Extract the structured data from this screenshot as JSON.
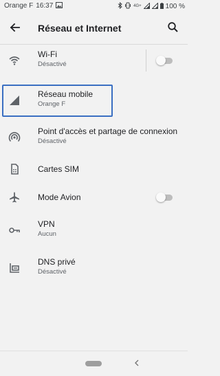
{
  "status_bar": {
    "carrier": "Orange F",
    "time": "16:37",
    "network": "4G+",
    "battery": "100 %"
  },
  "appbar": {
    "title": "Réseau et Internet"
  },
  "items": [
    {
      "label": "Wi-Fi",
      "sub": "Désactivé",
      "icon": "wifi-icon",
      "toggle_on": false
    },
    {
      "label": "Réseau mobile",
      "sub": "Orange F",
      "icon": "cellular-signal-icon"
    },
    {
      "label": "Point d'accès et partage de connexion",
      "sub": "Désactivé",
      "icon": "hotspot-icon"
    },
    {
      "label": "Cartes SIM",
      "icon": "sim-card-icon"
    },
    {
      "label": "Mode Avion",
      "icon": "airplane-icon",
      "toggle_on": false
    },
    {
      "label": "VPN",
      "sub": "Aucun",
      "icon": "vpn-key-icon"
    },
    {
      "label": "DNS privé",
      "sub": "Désactivé",
      "icon": "private-dns-icon"
    }
  ]
}
